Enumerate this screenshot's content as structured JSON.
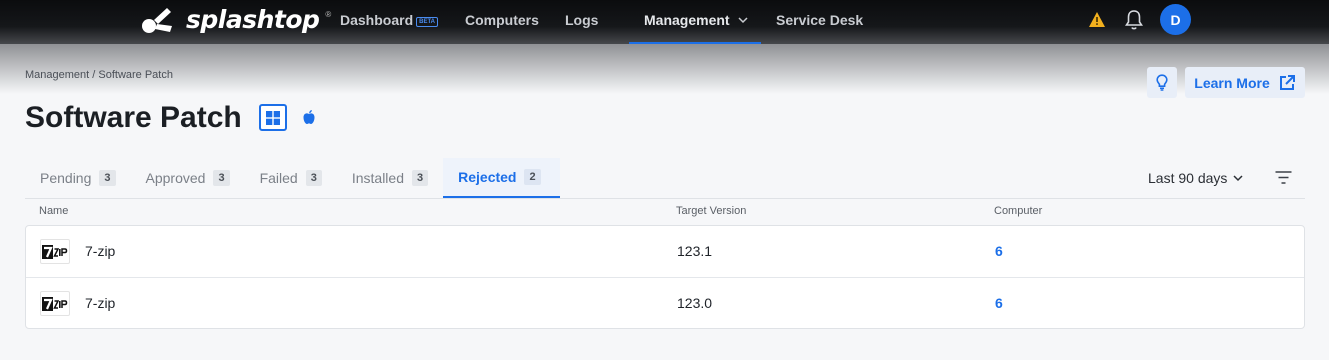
{
  "brand": {
    "name": "splashtop",
    "registered": "®"
  },
  "nav": {
    "items": [
      {
        "label": "Dashboard",
        "badge": "BETA"
      },
      {
        "label": "Computers"
      },
      {
        "label": "Logs"
      },
      {
        "label": "Management",
        "has_dropdown": true,
        "active": true
      },
      {
        "label": "Service Desk"
      }
    ],
    "avatar_initial": "D"
  },
  "breadcrumb": "Management / Software Patch",
  "header": {
    "title": "Software Patch",
    "learn_more": "Learn More",
    "os_filters": [
      "windows-icon",
      "apple-icon"
    ]
  },
  "tabs": [
    {
      "label": "Pending",
      "count": "3"
    },
    {
      "label": "Approved",
      "count": "3"
    },
    {
      "label": "Failed",
      "count": "3"
    },
    {
      "label": "Installed",
      "count": "3"
    },
    {
      "label": "Rejected",
      "count": "2",
      "active": true
    }
  ],
  "filters": {
    "range": "Last 90 days"
  },
  "table": {
    "columns": [
      "Name",
      "Target Version",
      "Computer"
    ],
    "rows": [
      {
        "name": "7-zip",
        "version": "123.1",
        "computers": "6"
      },
      {
        "name": "7-zip",
        "version": "123.0",
        "computers": "6"
      }
    ]
  },
  "colors": {
    "accent": "#1c6fe8",
    "topbar": "#111315",
    "warning": "#f2b01e"
  }
}
